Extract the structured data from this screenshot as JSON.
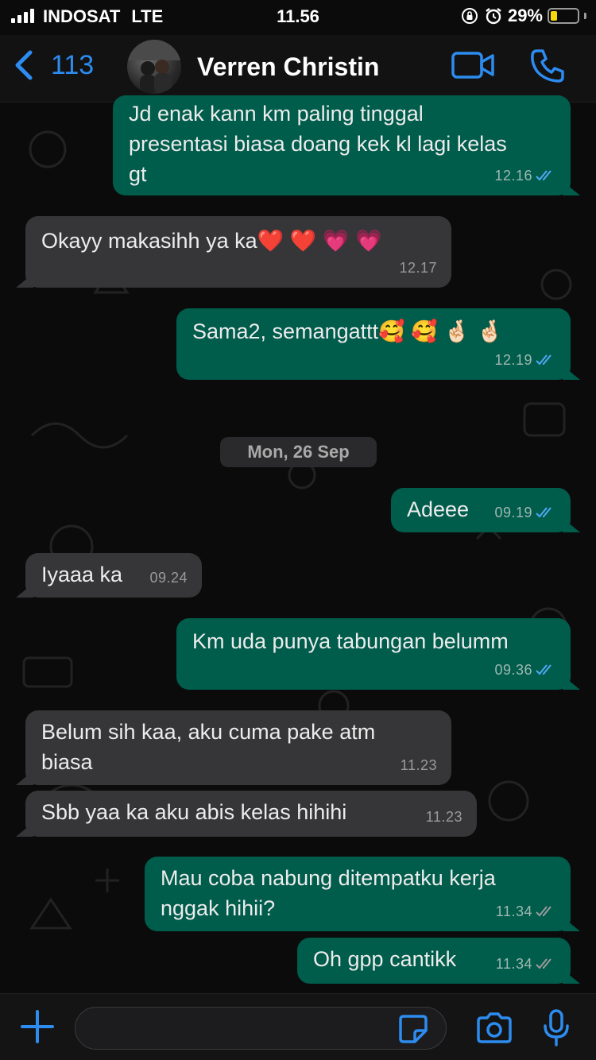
{
  "status_bar": {
    "carrier": "INDOSAT",
    "network": "LTE",
    "time": "11.56",
    "battery_percent": "29%",
    "battery_level": 0.29,
    "battery_color": "#f5d90a"
  },
  "header": {
    "back_count": "113",
    "contact_name": "Verren Christin",
    "accent_color": "#2d8cf0",
    "icons": [
      "chevron-left-icon",
      "video-call-icon",
      "phone-icon"
    ]
  },
  "date_separator": "Mon, 26 Sep",
  "messages": [
    {
      "direction": "out",
      "lines": [
        "Jd enak kann km paling tinggal",
        "presentasi biasa doang kek kl lagi kelas",
        "gt"
      ],
      "time": "12.16",
      "status": "read"
    },
    {
      "direction": "in",
      "lines": [
        "Okayy makasihh ya ka❤️ ❤️ 💗 💗"
      ],
      "time": "12.17"
    },
    {
      "direction": "out",
      "lines": [
        "Sama2, semangattt🥰 🥰 🤞🏻 🤞🏻"
      ],
      "time": "12.19",
      "status": "read"
    },
    {
      "direction": "out",
      "lines": [
        "Adeee"
      ],
      "time": "09.19",
      "status": "read"
    },
    {
      "direction": "in",
      "lines": [
        "Iyaaa ka"
      ],
      "time": "09.24"
    },
    {
      "direction": "out",
      "lines": [
        "Km uda punya tabungan belumm"
      ],
      "time": "09.36",
      "status": "read"
    },
    {
      "direction": "in",
      "lines": [
        "Belum sih kaa, aku cuma pake atm",
        "biasa"
      ],
      "time": "11.23"
    },
    {
      "direction": "in",
      "lines": [
        "Sbb yaa ka aku abis kelas hihihi"
      ],
      "time": "11.23"
    },
    {
      "direction": "out",
      "lines": [
        "Mau coba nabung ditempatku kerja",
        "nggak hihii?"
      ],
      "time": "11.34",
      "status": "delivered"
    },
    {
      "direction": "out",
      "lines": [
        "Oh gpp cantikk"
      ],
      "time": "11.34",
      "status": "delivered"
    }
  ],
  "composer": {
    "placeholder": "",
    "icons": [
      "plus-icon",
      "sticker-icon",
      "camera-icon",
      "microphone-icon"
    ]
  },
  "colors": {
    "outgoing_bubble": "#005c4b",
    "incoming_bubble": "#363638",
    "read_ticks": "#4fa8f5",
    "delivered_ticks": "#9a9a9a"
  }
}
